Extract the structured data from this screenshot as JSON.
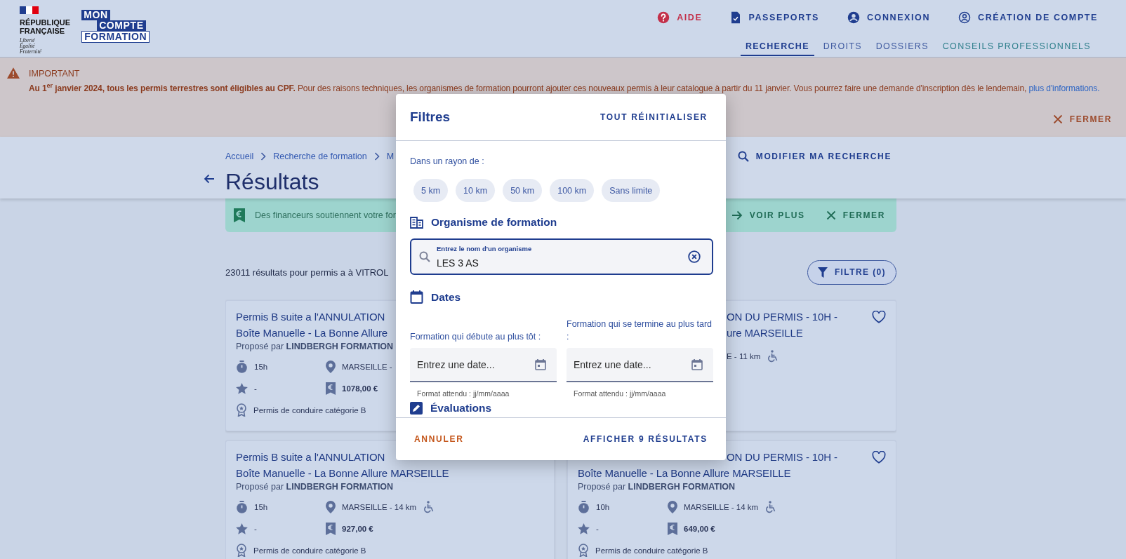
{
  "header": {
    "republic_lines": [
      "RÉPUBLIQUE",
      "FRANÇAISE"
    ],
    "motto_lines": [
      "Liberté",
      "Égalité",
      "Fraternité"
    ],
    "brand_lines": [
      "MON",
      "COMPTE",
      "FORMATION"
    ],
    "top_links": [
      {
        "label": "AIDE",
        "kind": "help"
      },
      {
        "label": "PASSEPORTS",
        "kind": "passport"
      },
      {
        "label": "CONNEXION",
        "kind": "login"
      },
      {
        "label": "CRÉATION DE COMPTE",
        "kind": "signup"
      }
    ],
    "tabs": [
      {
        "label": "RECHERCHE",
        "selected": true,
        "kind": "main"
      },
      {
        "label": "DROITS",
        "selected": false,
        "kind": "main"
      },
      {
        "label": "DOSSIERS",
        "selected": false,
        "kind": "main"
      },
      {
        "label": "CONSEILS PROFESSIONNELS",
        "selected": false,
        "kind": "advice"
      }
    ]
  },
  "notice": {
    "title": "IMPORTANT",
    "lead": "Au 1$^{er}$ janvier 2024, tous les permis terrestres sont éligibles au CPF.",
    "text": "Pour des raisons techniques, les organismes de formation pourront ajouter ces nouveaux permis à leur catalogue à partir du 11 janvier. Vous pourrez faire une demande d'inscription dès le lendemain,",
    "link": "plus d'informations.",
    "close": "FERMER"
  },
  "title_bar": {
    "breadcrumbs": [
      "Accueil",
      "Recherche de formation",
      "M"
    ],
    "title": "Résultats",
    "modify_search": "MODIFIER MA RECHERCHE"
  },
  "funding_banner": {
    "text": "Des financeurs soutiennent votre for",
    "more": "VOIR PLUS",
    "close": "FERMER"
  },
  "results": {
    "summary": "23011 résultats pour permis a à VITROL",
    "filter_button": "FILTRE (0)",
    "cards": [
      {
        "title_lines": [
          {
            "text": "Permis B suite a l'ANNULATION",
            "partial": false
          },
          {
            "text": "Boîte Manuelle - La Bonne Allure",
            "partial": false
          }
        ],
        "provider_prefix": "Proposé par",
        "provider": "LINDBERGH FORMATION",
        "meta": [
          {
            "kind": "duration",
            "text": "15h"
          },
          {
            "kind": "location",
            "text": "MARSEILLE -"
          },
          {
            "kind": "rating",
            "text": "-"
          },
          {
            "kind": "price",
            "text": "1078,00 €"
          },
          {
            "kind": "certification",
            "text": "Permis de conduire catégorie B"
          }
        ]
      },
      {
        "favorite": false,
        "accessible": true,
        "title_lines": [
          {
            "text": "ON DU PERMIS - 10H -",
            "partial": true
          },
          {
            "text": "ure MARSEILLE",
            "partial": true
          }
        ],
        "meta": [
          {
            "kind": "location-end",
            "text": "E - 11 km"
          }
        ]
      },
      {
        "accessible": true,
        "title_lines": [
          {
            "text": "Permis B suite a l'ANNULATION",
            "partial": false
          },
          {
            "text": "Boîte Manuelle - La Bonne Allure MARSEILLE",
            "partial": false
          }
        ],
        "provider_prefix": "Proposé par",
        "provider": "LINDBERGH FORMATION",
        "meta": [
          {
            "kind": "duration",
            "text": "15h"
          },
          {
            "kind": "location",
            "text": "MARSEILLE - 14 km"
          },
          {
            "kind": "rating",
            "text": "-"
          },
          {
            "kind": "price",
            "text": "927,00 €"
          },
          {
            "kind": "certification",
            "text": "Permis de conduire catégorie B"
          }
        ]
      },
      {
        "favorite": false,
        "accessible": true,
        "title_lines": [
          {
            "text": "ON DU PERMIS - 10H -",
            "partial": true
          },
          {
            "text": "Boîte Manuelle - La Bonne Allure MARSEILLE",
            "partial": false
          }
        ],
        "provider_prefix": "Proposé par",
        "provider": "LINDBERGH FORMATION",
        "meta": [
          {
            "kind": "duration",
            "text": "10h"
          },
          {
            "kind": "location",
            "text": "MARSEILLE - 14 km"
          },
          {
            "kind": "rating",
            "text": "-"
          },
          {
            "kind": "price",
            "text": "649,00 €"
          },
          {
            "kind": "certification",
            "text": "Permis de conduire catégorie B"
          }
        ]
      }
    ]
  },
  "filter_modal": {
    "title": "Filtres",
    "reset": "TOUT RÉINITIALISER",
    "radius_label": "Dans un rayon de :",
    "radius_options": [
      {
        "label": "5 km",
        "selected": false
      },
      {
        "label": "10 km",
        "selected": false
      },
      {
        "label": "50 km",
        "selected": false
      },
      {
        "label": "100 km",
        "selected": false
      },
      {
        "label": "Sans limite",
        "selected": false
      }
    ],
    "organisation": {
      "heading": "Organisme de formation",
      "label": "Entrez le nom d'un organisme",
      "value": "LES 3 AS"
    },
    "dates": {
      "heading": "Dates",
      "fields": [
        {
          "label": "Formation qui débute au plus tôt :",
          "placeholder": "Entrez une date...",
          "help": "Format attendu : jj/mm/aaaa"
        },
        {
          "label": "Formation qui se termine au plus tard :",
          "placeholder": "Entrez une date...",
          "help": "Format attendu : jj/mm/aaaa"
        }
      ]
    },
    "next_heading": "Évaluations",
    "cancel": "ANNULER",
    "apply": "AFFICHER 9 RÉSULTATS"
  }
}
